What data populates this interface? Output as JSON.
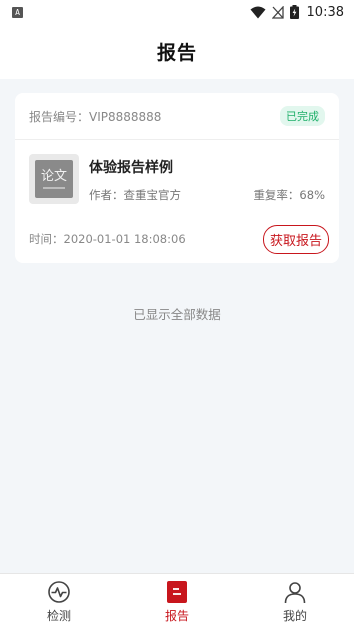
{
  "status_bar": {
    "left_badge": "A",
    "time": "10:38",
    "icons": [
      "wifi-icon",
      "no-signal-icon",
      "battery-charging-icon"
    ]
  },
  "header": {
    "title": "报告"
  },
  "report_card": {
    "report_no_label": "报告编号：",
    "report_no": "VIP8888888",
    "status": "已完成",
    "thumbnail_text": "论文",
    "title": "体验报告样例",
    "author": "作者：查重宝官方",
    "repeat_rate": "重复率：68%",
    "time": "时间：2020-01-01 18:08:06",
    "action_label": "获取报告"
  },
  "list_end": "已显示全部数据",
  "tabs": [
    {
      "label": "检测",
      "icon": "pulse-icon",
      "active": false
    },
    {
      "label": "报告",
      "icon": "report-icon",
      "active": true
    },
    {
      "label": "我的",
      "icon": "user-icon",
      "active": false
    }
  ],
  "colors": {
    "accent": "#c8161d",
    "success": "#1fb06a",
    "background": "#f3f6f9"
  }
}
